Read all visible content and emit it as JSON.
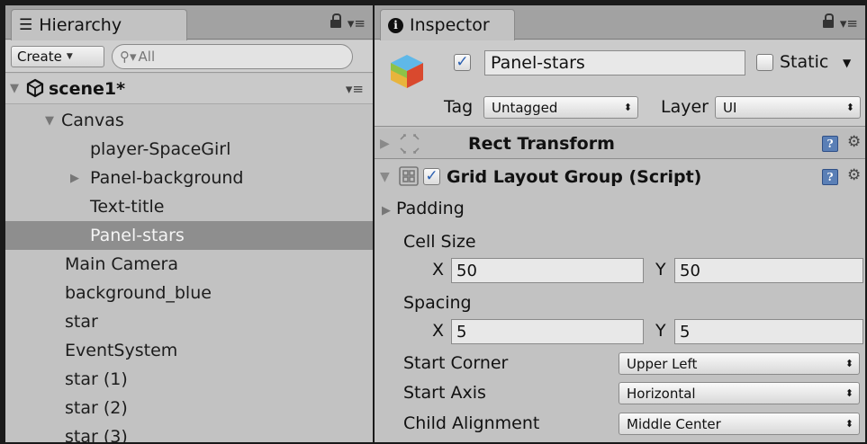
{
  "hierarchy": {
    "tab_label": "Hierarchy",
    "create_label": "Create",
    "search_placeholder": "All",
    "scene_name": "scene1*",
    "items": [
      {
        "label": "Canvas",
        "arrow": "▼"
      },
      {
        "label": "player-SpaceGirl"
      },
      {
        "label": "Panel-background",
        "arrow": "▶"
      },
      {
        "label": "Text-title"
      },
      {
        "label": "Panel-stars",
        "selected": true
      },
      {
        "label": "Main Camera"
      },
      {
        "label": "background_blue"
      },
      {
        "label": "star"
      },
      {
        "label": "EventSystem"
      },
      {
        "label": "star (1)"
      },
      {
        "label": "star (2)"
      },
      {
        "label": "star (3)"
      }
    ]
  },
  "inspector": {
    "tab_label": "Inspector",
    "object_name": "Panel-stars",
    "active": true,
    "static_label": "Static",
    "static": false,
    "tag_label": "Tag",
    "tag_value": "Untagged",
    "layer_label": "Layer",
    "layer_value": "UI",
    "rect_transform": {
      "title": "Rect Transform"
    },
    "grid_layout": {
      "title": "Grid Layout Group (Script)",
      "enabled": true,
      "padding_label": "Padding",
      "cell_size_label": "Cell Size",
      "cell_x_label": "X",
      "cell_x": "50",
      "cell_y_label": "Y",
      "cell_y": "50",
      "spacing_label": "Spacing",
      "spacing_x_label": "X",
      "spacing_x": "5",
      "spacing_y_label": "Y",
      "spacing_y": "5",
      "start_corner_label": "Start Corner",
      "start_corner": "Upper Left",
      "start_axis_label": "Start Axis",
      "start_axis": "Horizontal",
      "child_alignment_label": "Child Alignment",
      "child_alignment": "Middle Center"
    }
  }
}
